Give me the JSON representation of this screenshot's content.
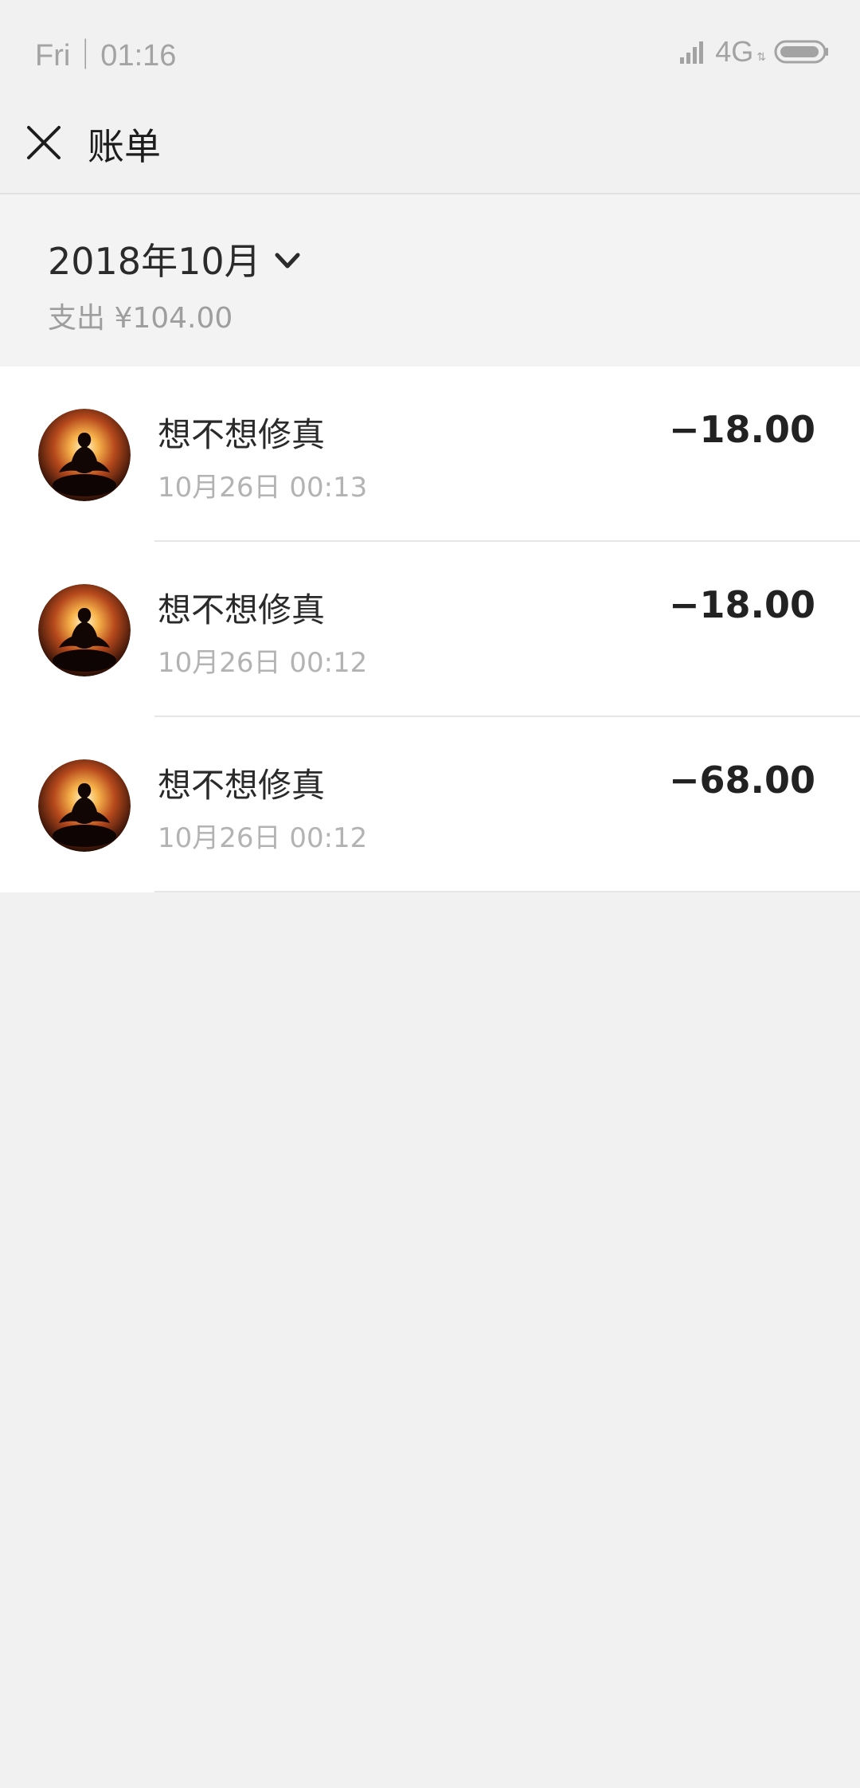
{
  "status_bar": {
    "time": "Fri｜01:16",
    "network": "4G",
    "network_sub": "⇅"
  },
  "header": {
    "title": "账单"
  },
  "summary": {
    "month": "2018年10月",
    "spend": "支出 ¥104.00"
  },
  "transactions": [
    {
      "title": "想不想修真",
      "time": "10月26日 00:13",
      "amount": "−18.00"
    },
    {
      "title": "想不想修真",
      "time": "10月26日 00:12",
      "amount": "−18.00"
    },
    {
      "title": "想不想修真",
      "time": "10月26日 00:12",
      "amount": "−68.00"
    }
  ],
  "colors": {
    "background": "#f1f1f1",
    "card": "#ffffff",
    "primary_text": "#2a2a2a",
    "secondary_text": "#b3b3b3"
  },
  "icons": {
    "close": "close-icon",
    "chevron": "chevron-down-icon",
    "signal": "signal-icon",
    "battery": "battery-icon"
  }
}
